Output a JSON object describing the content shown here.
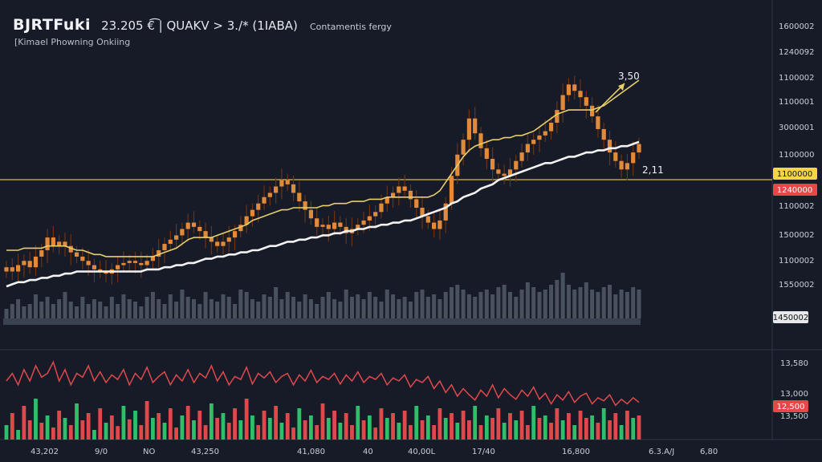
{
  "header": {
    "symbol": "BJRTFuki",
    "info": "23.205 €͡ | QUAKV > 3./* (1ΙΑΒΑ)",
    "description": "Contamentis fergy",
    "subtitle": "[Kimael Phowning Onkiing"
  },
  "price_axis": {
    "tick_labels": [
      "1600002",
      "1240092",
      "1100002",
      "1100001",
      "3000001",
      "1100000",
      "1100002",
      "1500002",
      "1100002",
      "1550002"
    ],
    "badges": [
      {
        "text": "1100000",
        "color": "#f5d547",
        "text_color": "#111111"
      },
      {
        "text": "1240000",
        "color": "#e44848",
        "text_color": "#ffffff"
      },
      {
        "text": "1450002",
        "color": "#e6e8ec",
        "text_color": "#111111"
      }
    ]
  },
  "osc_axis": {
    "tick_labels": [
      "13,580",
      "13,000",
      "13,500"
    ],
    "badges": [
      {
        "text": "12,500",
        "color": "#e44848",
        "text_color": "#ffffff"
      }
    ]
  },
  "time_axis": {
    "labels": [
      "43,202",
      "9/0",
      "NO",
      "43,250",
      "41,080",
      "40",
      "40,00L",
      "17/40",
      "16,800",
      "6.3.A/J",
      "6,80"
    ]
  },
  "annotations": [
    {
      "text": "3,50"
    },
    {
      "text": "2,11"
    }
  ],
  "colors": {
    "background": "#161b27",
    "bull": "#2fbf6a",
    "bear": "#e0494c",
    "candle_body": "#e28a3c",
    "candle_wick": "#6b3414",
    "ma_fast": "#e7cf6a",
    "ma_slow": "#f2f2f2",
    "hline": "#b8a33a",
    "volume": "#525a6a",
    "oscillator": "#e0494c",
    "grid": "#2a3040"
  },
  "chart_data": [
    {
      "type": "candlestick",
      "name": "price",
      "y_axis_ticks": [
        "1600002",
        "1240092",
        "1100002",
        "1100001",
        "3000001",
        "1100000",
        "1100002",
        "1500002",
        "1100002",
        "1550002"
      ],
      "close": [
        0.12,
        0.1,
        0.13,
        0.15,
        0.12,
        0.17,
        0.2,
        0.26,
        0.22,
        0.24,
        0.22,
        0.19,
        0.17,
        0.15,
        0.13,
        0.11,
        0.1,
        0.09,
        0.11,
        0.13,
        0.14,
        0.15,
        0.14,
        0.13,
        0.15,
        0.17,
        0.2,
        0.23,
        0.25,
        0.27,
        0.3,
        0.33,
        0.31,
        0.29,
        0.26,
        0.24,
        0.22,
        0.24,
        0.26,
        0.29,
        0.32,
        0.36,
        0.39,
        0.42,
        0.45,
        0.47,
        0.5,
        0.53,
        0.51,
        0.47,
        0.43,
        0.39,
        0.35,
        0.31,
        0.32,
        0.3,
        0.33,
        0.31,
        0.28,
        0.3,
        0.32,
        0.34,
        0.36,
        0.38,
        0.42,
        0.45,
        0.47,
        0.5,
        0.48,
        0.44,
        0.4,
        0.36,
        0.33,
        0.3,
        0.34,
        0.42,
        0.55,
        0.65,
        0.72,
        0.82,
        0.75,
        0.68,
        0.63,
        0.58,
        0.56,
        0.55,
        0.58,
        0.62,
        0.66,
        0.7,
        0.72,
        0.74,
        0.76,
        0.8,
        0.86,
        0.93,
        0.98,
        0.95,
        0.92,
        0.88,
        0.83,
        0.77,
        0.72,
        0.66,
        0.62,
        0.58,
        0.61,
        0.66,
        0.7
      ],
      "moving_averages": [
        {
          "label": "fast",
          "values": [
            0.2,
            0.2,
            0.2,
            0.21,
            0.21,
            0.21,
            0.21,
            0.22,
            0.22,
            0.22,
            0.22,
            0.21,
            0.2,
            0.2,
            0.19,
            0.18,
            0.18,
            0.17,
            0.17,
            0.17,
            0.17,
            0.17,
            0.17,
            0.17,
            0.17,
            0.17,
            0.18,
            0.19,
            0.2,
            0.21,
            0.23,
            0.25,
            0.26,
            0.26,
            0.26,
            0.26,
            0.27,
            0.28,
            0.29,
            0.3,
            0.31,
            0.32,
            0.34,
            0.35,
            0.36,
            0.37,
            0.38,
            0.39,
            0.39,
            0.4,
            0.4,
            0.4,
            0.4,
            0.4,
            0.41,
            0.41,
            0.42,
            0.42,
            0.42,
            0.43,
            0.43,
            0.43,
            0.44,
            0.44,
            0.44,
            0.45,
            0.45,
            0.45,
            0.45,
            0.45,
            0.45,
            0.45,
            0.45,
            0.46,
            0.48,
            0.52,
            0.56,
            0.6,
            0.64,
            0.67,
            0.69,
            0.7,
            0.71,
            0.72,
            0.72,
            0.73,
            0.73,
            0.74,
            0.74,
            0.75,
            0.76,
            0.78,
            0.8,
            0.82,
            0.84,
            0.85,
            0.86,
            0.86,
            0.86,
            0.86,
            0.86,
            0.87,
            0.88,
            0.9,
            0.92,
            0.94,
            0.96,
            0.98,
            1.0
          ]
        },
        {
          "label": "slow",
          "values": [
            0.03,
            0.04,
            0.05,
            0.05,
            0.06,
            0.06,
            0.07,
            0.07,
            0.08,
            0.08,
            0.09,
            0.09,
            0.1,
            0.1,
            0.1,
            0.1,
            0.1,
            0.1,
            0.1,
            0.1,
            0.1,
            0.1,
            0.1,
            0.1,
            0.11,
            0.11,
            0.11,
            0.12,
            0.12,
            0.13,
            0.13,
            0.14,
            0.14,
            0.15,
            0.16,
            0.16,
            0.17,
            0.17,
            0.18,
            0.18,
            0.19,
            0.19,
            0.2,
            0.2,
            0.21,
            0.22,
            0.22,
            0.23,
            0.24,
            0.24,
            0.25,
            0.25,
            0.26,
            0.26,
            0.27,
            0.27,
            0.28,
            0.28,
            0.29,
            0.29,
            0.3,
            0.3,
            0.31,
            0.31,
            0.32,
            0.32,
            0.33,
            0.33,
            0.34,
            0.34,
            0.35,
            0.36,
            0.37,
            0.38,
            0.39,
            0.4,
            0.42,
            0.43,
            0.45,
            0.46,
            0.47,
            0.49,
            0.5,
            0.51,
            0.53,
            0.54,
            0.55,
            0.56,
            0.57,
            0.58,
            0.59,
            0.6,
            0.61,
            0.61,
            0.62,
            0.63,
            0.64,
            0.64,
            0.65,
            0.66,
            0.66,
            0.67,
            0.67,
            0.68,
            0.68,
            0.69,
            0.69,
            0.7,
            0.71
          ]
        }
      ],
      "horizontal_line": {
        "label": "1100000"
      }
    },
    {
      "type": "bar",
      "name": "volume",
      "values": [
        0.2,
        0.3,
        0.4,
        0.25,
        0.3,
        0.5,
        0.35,
        0.45,
        0.3,
        0.4,
        0.55,
        0.35,
        0.25,
        0.45,
        0.3,
        0.4,
        0.35,
        0.25,
        0.45,
        0.3,
        0.5,
        0.4,
        0.35,
        0.25,
        0.45,
        0.55,
        0.4,
        0.3,
        0.5,
        0.35,
        0.6,
        0.45,
        0.4,
        0.3,
        0.55,
        0.4,
        0.35,
        0.5,
        0.45,
        0.3,
        0.6,
        0.55,
        0.4,
        0.35,
        0.5,
        0.45,
        0.65,
        0.4,
        0.55,
        0.45,
        0.35,
        0.5,
        0.4,
        0.3,
        0.45,
        0.55,
        0.4,
        0.35,
        0.6,
        0.45,
        0.5,
        0.4,
        0.55,
        0.45,
        0.35,
        0.6,
        0.5,
        0.4,
        0.45,
        0.35,
        0.55,
        0.6,
        0.45,
        0.5,
        0.4,
        0.55,
        0.65,
        0.7,
        0.6,
        0.5,
        0.45,
        0.55,
        0.6,
        0.5,
        0.65,
        0.7,
        0.55,
        0.45,
        0.6,
        0.75,
        0.65,
        0.55,
        0.6,
        0.7,
        0.8,
        0.95,
        0.7,
        0.6,
        0.65,
        0.75,
        0.6,
        0.55,
        0.65,
        0.7,
        0.5,
        0.6,
        0.55,
        0.65,
        0.6
      ]
    },
    {
      "type": "line",
      "name": "oscillator",
      "values": [
        0.6,
        0.7,
        0.55,
        0.75,
        0.6,
        0.8,
        0.65,
        0.7,
        0.85,
        0.6,
        0.75,
        0.55,
        0.7,
        0.65,
        0.8,
        0.6,
        0.72,
        0.58,
        0.68,
        0.62,
        0.75,
        0.55,
        0.7,
        0.62,
        0.78,
        0.58,
        0.66,
        0.72,
        0.55,
        0.68,
        0.6,
        0.75,
        0.58,
        0.7,
        0.64,
        0.8,
        0.6,
        0.72,
        0.55,
        0.66,
        0.62,
        0.78,
        0.56,
        0.7,
        0.64,
        0.72,
        0.58,
        0.66,
        0.7,
        0.55,
        0.68,
        0.6,
        0.74,
        0.58,
        0.66,
        0.62,
        0.7,
        0.56,
        0.68,
        0.6,
        0.72,
        0.58,
        0.66,
        0.62,
        0.7,
        0.55,
        0.64,
        0.6,
        0.68,
        0.52,
        0.62,
        0.58,
        0.66,
        0.5,
        0.6,
        0.45,
        0.55,
        0.4,
        0.5,
        0.42,
        0.35,
        0.48,
        0.4,
        0.55,
        0.38,
        0.5,
        0.42,
        0.36,
        0.48,
        0.4,
        0.52,
        0.36,
        0.44,
        0.3,
        0.42,
        0.35,
        0.46,
        0.32,
        0.4,
        0.44,
        0.3,
        0.38,
        0.34,
        0.42,
        0.28,
        0.36,
        0.3,
        0.38,
        0.32
      ]
    },
    {
      "type": "bar",
      "name": "histogram",
      "values": [
        0.3,
        0.55,
        0.2,
        0.7,
        0.4,
        0.85,
        0.35,
        0.5,
        0.25,
        0.6,
        0.45,
        0.3,
        0.75,
        0.4,
        0.55,
        0.2,
        0.65,
        0.35,
        0.5,
        0.28,
        0.7,
        0.42,
        0.6,
        0.3,
        0.8,
        0.45,
        0.55,
        0.35,
        0.65,
        0.25,
        0.5,
        0.7,
        0.4,
        0.6,
        0.3,
        0.75,
        0.45,
        0.55,
        0.35,
        0.65,
        0.4,
        0.85,
        0.5,
        0.3,
        0.6,
        0.45,
        0.7,
        0.35,
        0.55,
        0.25,
        0.65,
        0.4,
        0.5,
        0.3,
        0.75,
        0.45,
        0.6,
        0.35,
        0.55,
        0.3,
        0.7,
        0.4,
        0.5,
        0.25,
        0.65,
        0.45,
        0.55,
        0.35,
        0.6,
        0.3,
        0.7,
        0.4,
        0.5,
        0.3,
        0.65,
        0.45,
        0.55,
        0.35,
        0.6,
        0.4,
        0.7,
        0.3,
        0.5,
        0.45,
        0.65,
        0.35,
        0.55,
        0.4,
        0.6,
        0.3,
        0.7,
        0.45,
        0.5,
        0.35,
        0.65,
        0.4,
        0.55,
        0.3,
        0.6,
        0.45,
        0.5,
        0.35,
        0.65,
        0.4,
        0.55,
        0.3,
        0.6,
        0.45,
        0.5
      ],
      "colors": [
        "bull",
        "bear",
        "bull",
        "bear",
        "bear",
        "bull",
        "bear",
        "bull",
        "bear",
        "bear",
        "bull",
        "bear",
        "bull",
        "bear",
        "bear",
        "bull",
        "bear",
        "bull",
        "bear",
        "bear",
        "bull",
        "bear",
        "bull",
        "bear",
        "bear",
        "bull",
        "bear",
        "bull",
        "bear",
        "bear",
        "bull",
        "bear",
        "bull",
        "bear",
        "bear",
        "bull",
        "bear",
        "bull",
        "bear",
        "bear",
        "bull",
        "bear",
        "bull",
        "bear",
        "bear",
        "bull",
        "bear",
        "bull",
        "bear",
        "bear",
        "bull",
        "bear",
        "bull",
        "bear",
        "bear",
        "bull",
        "bear",
        "bull",
        "bear",
        "bear",
        "bull",
        "bear",
        "bull",
        "bear",
        "bear",
        "bull",
        "bear",
        "bull",
        "bear",
        "bear",
        "bull",
        "bear",
        "bull",
        "bear",
        "bear",
        "bull",
        "bear",
        "bull",
        "bear",
        "bear",
        "bull",
        "bear",
        "bull",
        "bear",
        "bear",
        "bull",
        "bear",
        "bull",
        "bear",
        "bear",
        "bull",
        "bear",
        "bull",
        "bear",
        "bear",
        "bull",
        "bear",
        "bull",
        "bear",
        "bear",
        "bull",
        "bear",
        "bull",
        "bear",
        "bear",
        "bull",
        "bear",
        "bull",
        "bear"
      ]
    }
  ]
}
